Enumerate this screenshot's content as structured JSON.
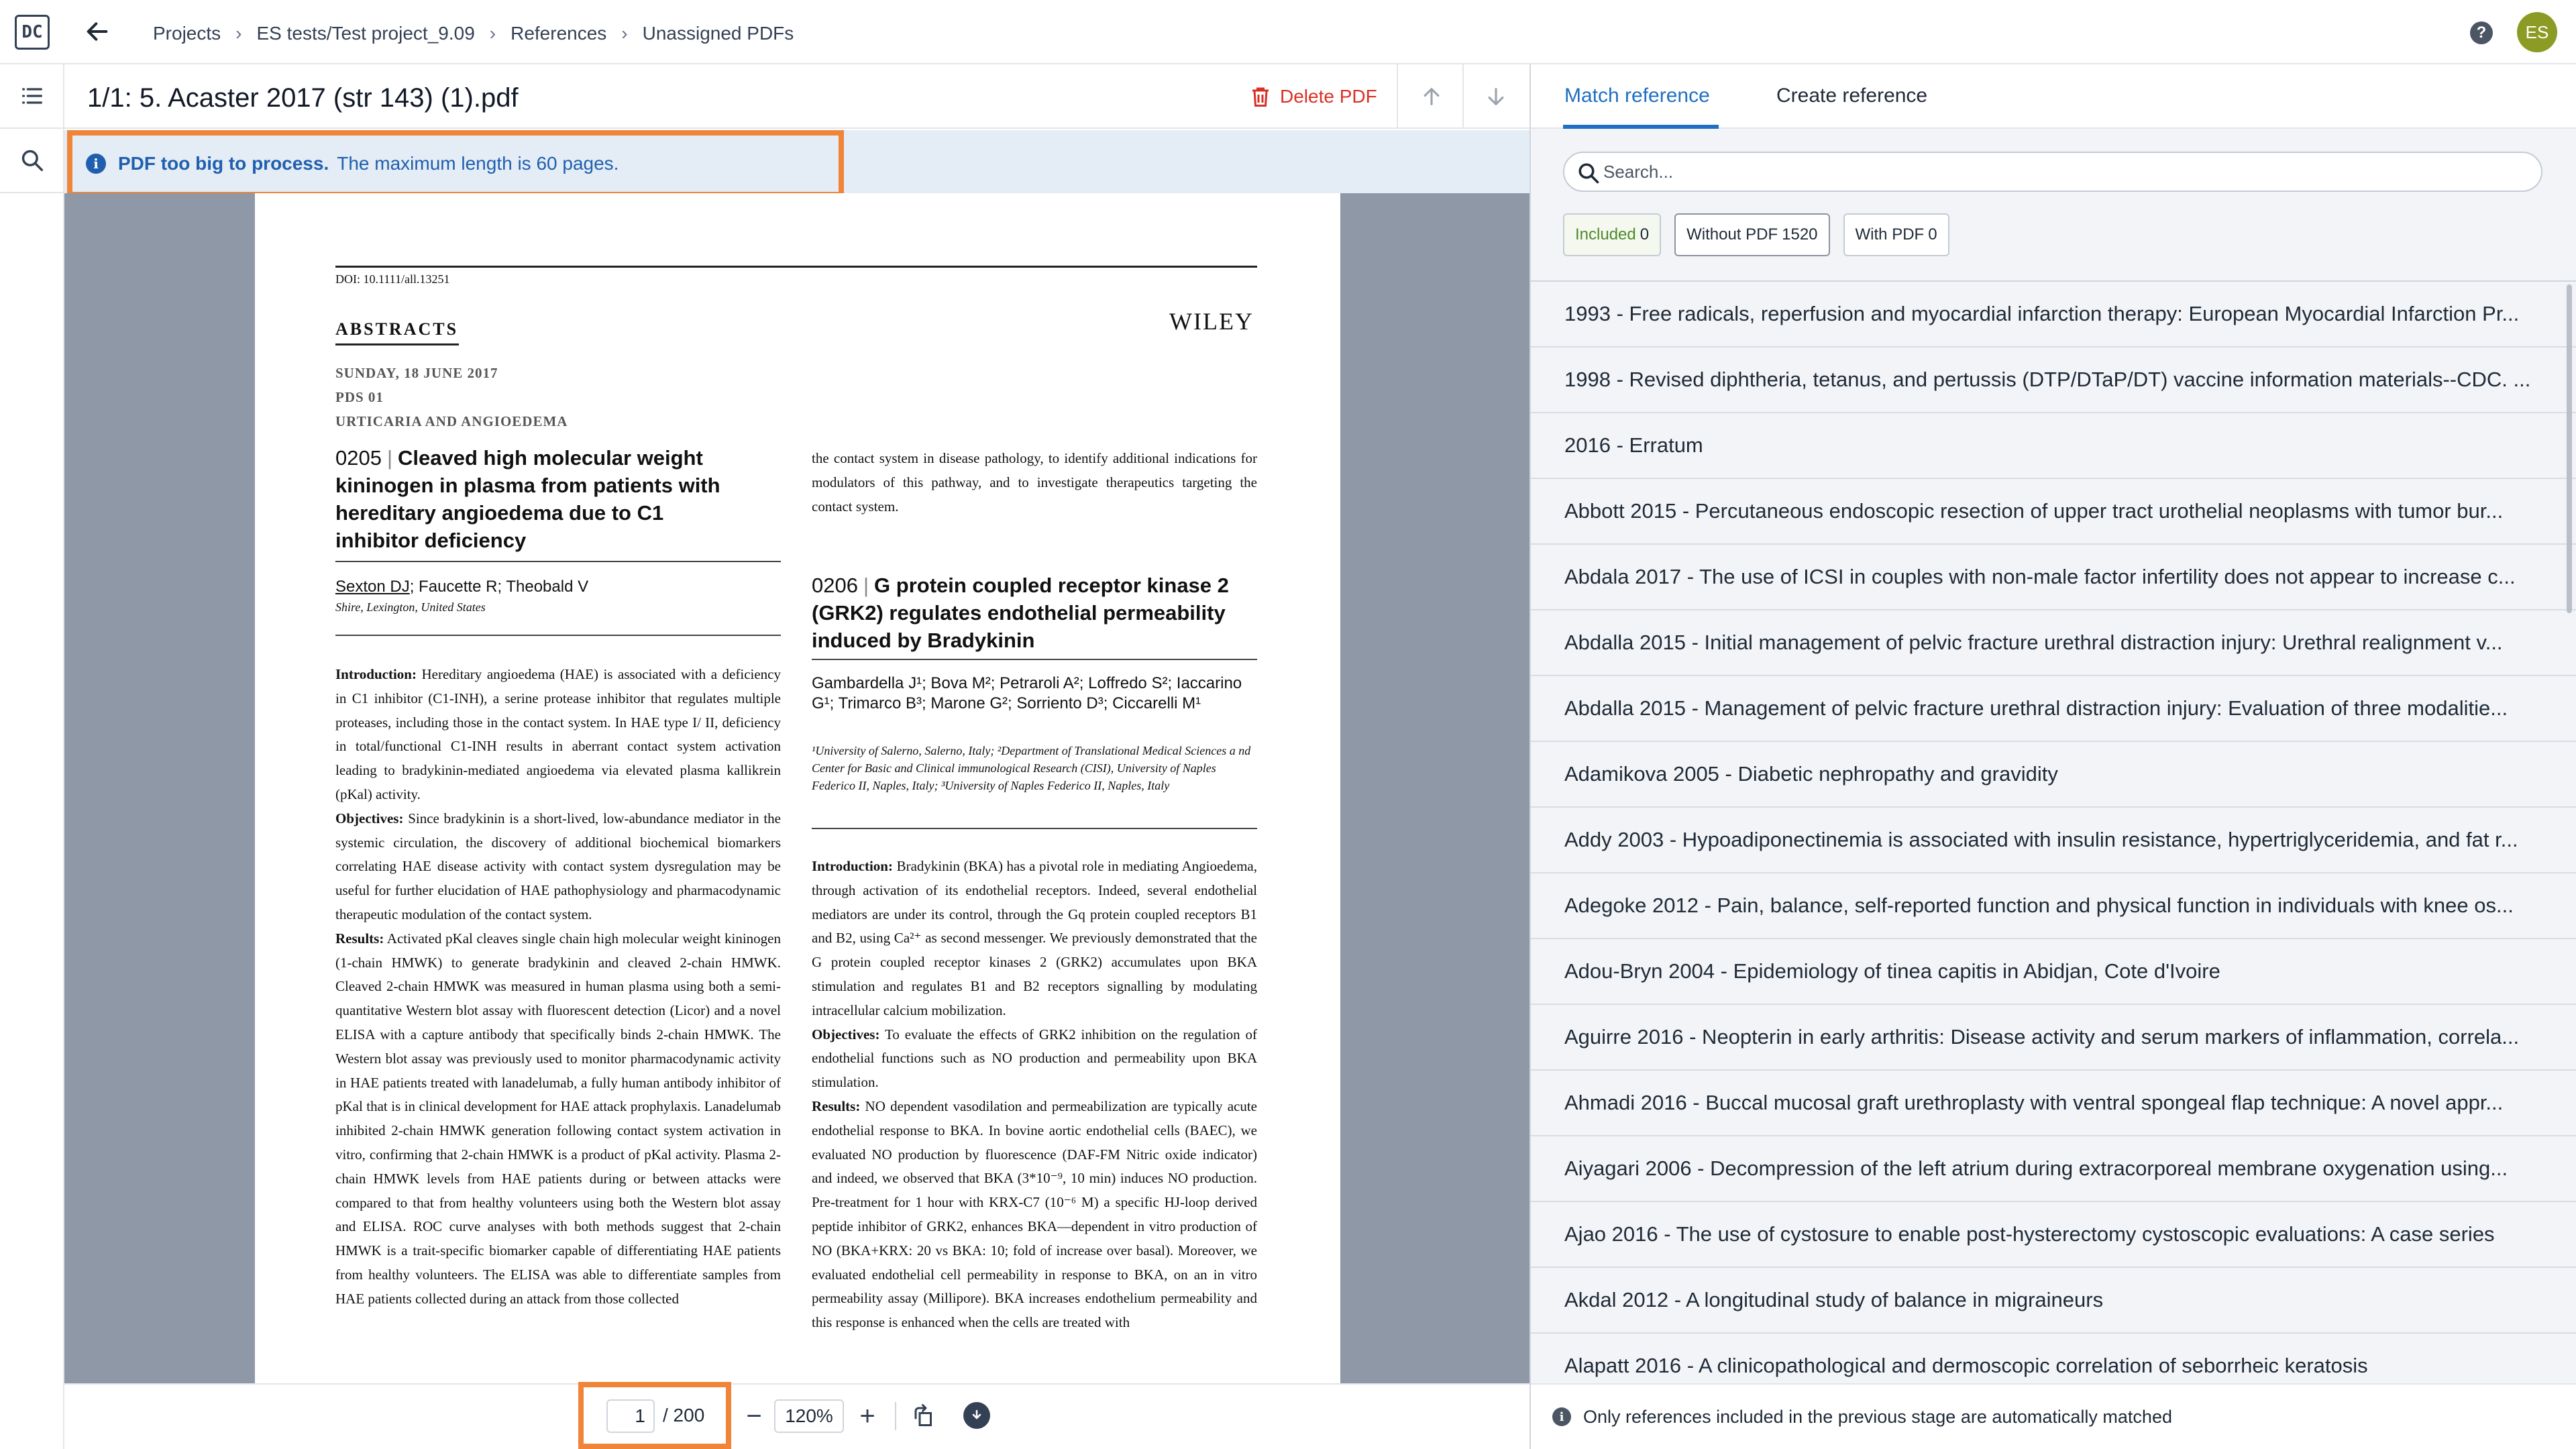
{
  "topbar": {
    "logo_text": "DC",
    "breadcrumb": [
      "Projects",
      "ES tests/Test project_9.09",
      "References",
      "Unassigned PDFs"
    ],
    "help_label": "?",
    "avatar_initials": "ES"
  },
  "document": {
    "title": "1/1: 5. Acaster 2017 (str 143) (1).pdf",
    "delete_label": "Delete PDF",
    "banner_bold": "PDF too big to process.",
    "banner_text": "The maximum length is 60 pages."
  },
  "pdf_page": {
    "doi": "DOI: 10.1111/all.13251",
    "publisher": "WILEY",
    "heading": "ABSTRACTS",
    "date_line": "SUNDAY, 18 JUNE 2017",
    "session": "PDS 01",
    "topic": "URTICARIA AND ANGIOEDEMA",
    "a1_number": "0205",
    "a1_title": "Cleaved high molecular weight kininogen in plasma from patients with hereditary angioedema due to C1 inhibitor deficiency",
    "a1_first_author": "Sexton DJ",
    "a1_other_authors": "; Faucette R; Theobald V",
    "a1_affiliation": "Shire, Lexington, United States",
    "a1_intro_label": "Introduction:",
    "a1_intro": "Hereditary angioedema (HAE) is associated with a deficiency in C1 inhibitor (C1-INH), a serine protease inhibitor that regulates multiple proteases, including those in the contact system. In HAE type I/ II, deficiency in total/functional C1-INH results in aberrant contact system activation leading to bradykinin-mediated angioedema via elevated plasma kallikrein (pKal) activity.",
    "a1_obj_label": "Objectives:",
    "a1_obj": "Since bradykinin is a short-lived, low-abundance mediator in the systemic circulation, the discovery of additional biochemical biomarkers correlating HAE disease activity with contact system dysregulation may be useful for further elucidation of HAE pathophysiology and pharmacodynamic therapeutic modulation of the contact system.",
    "a1_res_label": "Results:",
    "a1_res": "Activated pKal cleaves single chain high molecular weight kininogen (1-chain HMWK) to generate bradykinin and cleaved 2-chain HMWK. Cleaved 2-chain HMWK was measured in human plasma using both a semi-quantitative Western blot assay with fluorescent detection (Licor) and a novel ELISA with a capture antibody that specifically binds 2-chain HMWK. The Western blot assay was previously used to monitor pharmacodynamic activity in HAE patients treated with lanadelumab, a fully human antibody inhibitor of pKal that is in clinical development for HAE attack prophylaxis. Lanadelumab inhibited 2-chain HMWK generation following contact system activation in vitro, confirming that 2-chain HMWK is a product of pKal activity. Plasma 2-chain HMWK levels from HAE patients during or between attacks were compared to that from healthy volunteers using both the Western blot assay and ELISA. ROC curve analyses with both methods suggest that 2-chain HMWK is a trait-specific biomarker capable of differentiating HAE patients from healthy volunteers. The ELISA was able to differentiate samples from HAE patients collected during an attack from those collected",
    "a1_continued": "the contact system in disease pathology, to identify additional indications for modulators of this pathway, and to investigate therapeutics targeting the contact system.",
    "a2_number": "0206",
    "a2_title": "G protein coupled receptor kinase 2 (GRK2) regulates endothelial permeability induced by Bradykinin",
    "a2_authors": "Gambardella J¹; Bova M²; Petraroli A²; Loffredo S²; Iaccarino G¹; Trimarco B³; Marone G²; Sorriento D³; Ciccarelli M¹",
    "a2_affiliation": "¹University of Salerno, Salerno, Italy; ²Department of Translational Medical Sciences a nd Center for Basic and Clinical immunological Research (CISI), University of Naples Federico II, Naples, Italy; ³University of Naples Federico II, Naples, Italy",
    "a2_intro_label": "Introduction:",
    "a2_intro": "Bradykinin (BKA) has a pivotal role in mediating Angioedema, through activation of its endothelial receptors. Indeed, several endothelial mediators are under its control, through the Gq protein coupled receptors B1 and B2, using Ca²⁺ as second messenger. We previously demonstrated that the G protein coupled receptor kinases 2 (GRK2) accumulates upon BKA stimulation and regulates B1 and B2 receptors signalling by modulating intracellular calcium mobilization.",
    "a2_obj_label": "Objectives:",
    "a2_obj": "To evaluate the effects of GRK2 inhibition on the regulation of endothelial functions such as NO production and permeability upon BKA stimulation.",
    "a2_res_label": "Results:",
    "a2_res": "NO dependent vasodilation and permeabilization are typically acute endothelial response to BKA. In bovine aortic endothelial cells (BAEC), we evaluated NO production by fluorescence (DAF-FM Nitric oxide indicator) and indeed, we observed that BKA (3*10⁻⁹, 10 min) induces NO production. Pre-treatment for 1 hour with KRX-C7 (10⁻⁶ M) a specific HJ-loop derived peptide inhibitor of GRK2, enhances BKA—dependent in vitro production of NO (BKA+KRX: 20 vs BKA: 10; fold of increase over basal). Moreover, we evaluated endothelial cell permeability in response to BKA, on an in vitro permeability assay (Millipore). BKA increases endothelium permeability and this response is enhanced when the cells are treated with"
  },
  "viewer_toolbar": {
    "page_current": "1",
    "page_total": "/ 200",
    "zoom": "120%",
    "zoom_out_label": "−",
    "zoom_in_label": "+"
  },
  "right_panel": {
    "tabs": [
      "Match reference",
      "Create reference"
    ],
    "search_placeholder": "Search...",
    "filters": [
      {
        "label": "Included",
        "count": "0"
      },
      {
        "label": "Without PDF",
        "count": "1520"
      },
      {
        "label": "With PDF",
        "count": "0"
      }
    ],
    "references": [
      "1993 - Free radicals, reperfusion and myocardial infarction therapy: European Myocardial Infarction Pr...",
      "1998 - Revised diphtheria, tetanus, and pertussis (DTP/DTaP/DT) vaccine information materials--CDC. ...",
      "2016 - Erratum",
      "Abbott 2015 - Percutaneous endoscopic resection of upper tract urothelial neoplasms with tumor bur...",
      "Abdala 2017 - The use of ICSI in couples with non-male factor infertility does not appear to increase c...",
      "Abdalla 2015 - Initial management of pelvic fracture urethral distraction injury: Urethral realignment v...",
      "Abdalla 2015 - Management of pelvic fracture urethral distraction injury: Evaluation of three modalitie...",
      "Adamikova 2005 - Diabetic nephropathy and gravidity",
      "Addy 2003 - Hypoadiponectinemia is associated with insulin resistance, hypertriglyceridemia, and fat r...",
      "Adegoke 2012 - Pain, balance, self-reported function and physical function in individuals with knee os...",
      "Adou-Bryn 2004 - Epidemiology of tinea capitis in Abidjan, Cote d'Ivoire",
      "Aguirre 2016 - Neopterin in early arthritis: Disease activity and serum markers of inflammation, correla...",
      "Ahmadi 2016 - Buccal mucosal graft urethroplasty with ventral spongeal flap technique: A novel appr...",
      "Aiyagari 2006 - Decompression of the left atrium during extracorporeal membrane oxygenation using...",
      "Ajao 2016 - The use of cystosure to enable post-hysterectomy cystoscopic evaluations: A case series",
      "Akdal 2012 - A longitudinal study of balance in migraineurs",
      "Alapatt 2016 - A clinicopathological and dermoscopic correlation of seborrheic keratosis"
    ],
    "footer_note": "Only references included in the previous stage are automatically matched"
  }
}
